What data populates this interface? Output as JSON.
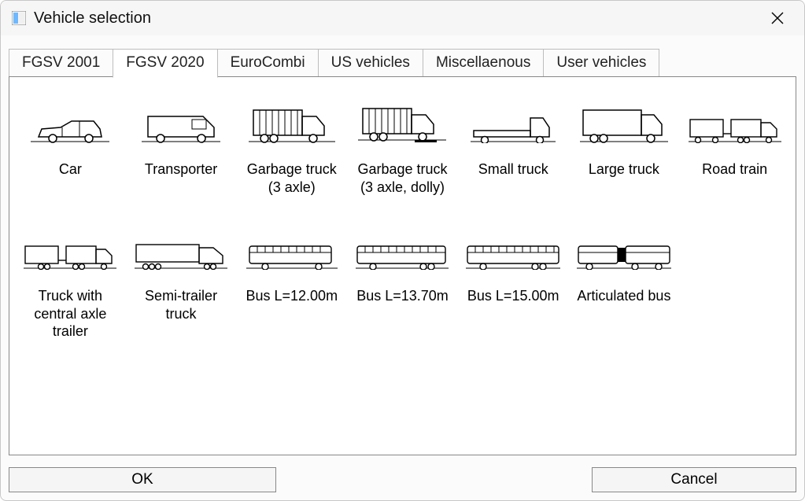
{
  "window": {
    "title": "Vehicle selection"
  },
  "tabs": [
    {
      "label": "FGSV 2001",
      "active": false
    },
    {
      "label": "FGSV 2020",
      "active": true
    },
    {
      "label": "EuroCombi",
      "active": false
    },
    {
      "label": "US vehicles",
      "active": false
    },
    {
      "label": "Miscellaenous",
      "active": false
    },
    {
      "label": "User vehicles",
      "active": false
    }
  ],
  "vehicles": [
    {
      "label": "Car",
      "icon": "car-icon"
    },
    {
      "label": "Transporter",
      "icon": "van-icon"
    },
    {
      "label": "Garbage truck (3 axle)",
      "icon": "garbage-truck-icon"
    },
    {
      "label": "Garbage truck (3 axle, dolly)",
      "icon": "garbage-truck-dolly-icon"
    },
    {
      "label": "Small truck",
      "icon": "small-truck-icon"
    },
    {
      "label": "Large truck",
      "icon": "large-truck-icon"
    },
    {
      "label": "Road train",
      "icon": "road-train-icon"
    },
    {
      "label": "Truck with central axle trailer",
      "icon": "central-axle-trailer-icon"
    },
    {
      "label": "Semi-trailer truck",
      "icon": "semi-trailer-icon"
    },
    {
      "label": "Bus L=12.00m",
      "icon": "bus-12-icon"
    },
    {
      "label": "Bus L=13.70m",
      "icon": "bus-137-icon"
    },
    {
      "label": "Bus L=15.00m",
      "icon": "bus-15-icon"
    },
    {
      "label": "Articulated bus",
      "icon": "articulated-bus-icon"
    }
  ],
  "buttons": {
    "ok": "OK",
    "cancel": "Cancel"
  }
}
